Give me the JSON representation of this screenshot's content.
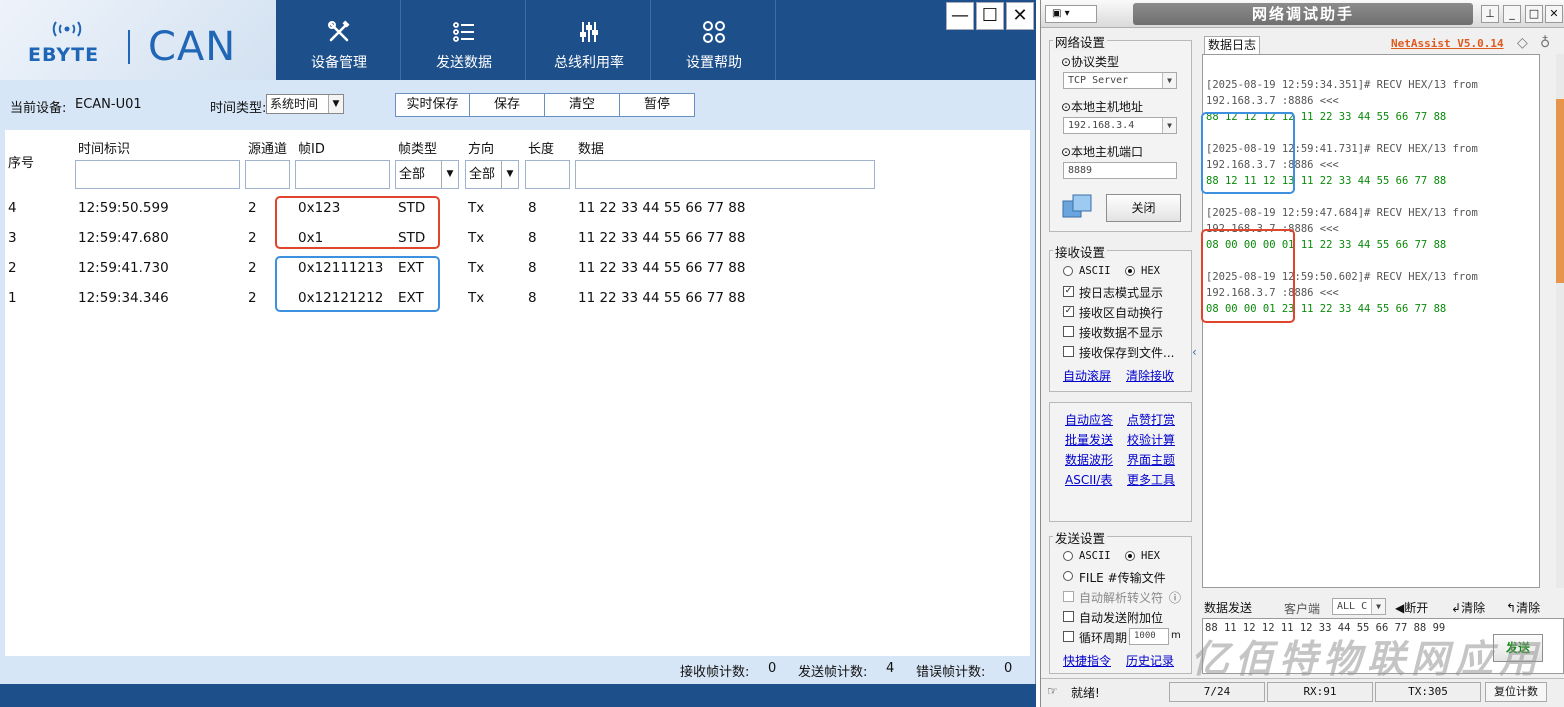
{
  "ecan": {
    "brand_text": "EBYTE",
    "product_text": "CAN",
    "nav": [
      {
        "label": "设备管理",
        "icon": "tools-icon"
      },
      {
        "label": "发送数据",
        "icon": "list-icon"
      },
      {
        "label": "总线利用率",
        "icon": "sliders-icon"
      },
      {
        "label": "设置帮助",
        "icon": "grid-circles-icon"
      }
    ],
    "window_buttons": [
      "—",
      "☐",
      "✕"
    ],
    "device_label": "当前设备:",
    "device_value": "ECAN-U01",
    "time_type_label": "时间类型:",
    "time_type_value": "系统时间",
    "actions": [
      "实时保存",
      "保存",
      "清空",
      "暂停"
    ],
    "columns": {
      "index": "序号",
      "timestamp": "时间标识",
      "channel": "源通道",
      "frame_id": "帧ID",
      "frame_type": "帧类型",
      "direction": "方向",
      "length": "长度",
      "data": "数据"
    },
    "filters": {
      "frame_type": "全部",
      "direction": "全部"
    },
    "rows": [
      {
        "index": "4",
        "time": "12:59:50.599",
        "channel": "2",
        "id": "0x123",
        "type": "STD",
        "dir": "Tx",
        "len": "8",
        "data": "11 22 33 44 55 66 77 88"
      },
      {
        "index": "3",
        "time": "12:59:47.680",
        "channel": "2",
        "id": "0x1",
        "type": "STD",
        "dir": "Tx",
        "len": "8",
        "data": "11 22 33 44 55 66 77 88"
      },
      {
        "index": "2",
        "time": "12:59:41.730",
        "channel": "2",
        "id": "0x12111213",
        "type": "EXT",
        "dir": "Tx",
        "len": "8",
        "data": "11 22 33 44 55 66 77 88"
      },
      {
        "index": "1",
        "time": "12:59:34.346",
        "channel": "2",
        "id": "0x12121212",
        "type": "EXT",
        "dir": "Tx",
        "len": "8",
        "data": "11 22 33 44 55 66 77 88"
      }
    ],
    "status": {
      "recv_label": "接收帧计数:",
      "recv_value": "0",
      "send_label": "发送帧计数:",
      "send_value": "4",
      "err_label": "错误帧计数:",
      "err_value": "0"
    },
    "highlight_colors": {
      "red": "#e0442a",
      "blue": "#3d8fe0"
    },
    "colors": {
      "nav_bg": "#1d4f8b",
      "body_bg": "#d7e6f7",
      "brand": "#2066b6"
    }
  },
  "net": {
    "title": "网络调试助手",
    "version": "NetAssist V5.0.14",
    "net_settings": {
      "group_title": "网络设置",
      "protocol_label": "⊙协议类型",
      "protocol_value": "TCP Server",
      "host_label": "⊙本地主机地址",
      "host_value": "192.168.3.4",
      "port_label": "⊙本地主机端口",
      "port_value": "8889",
      "close_button": "关闭"
    },
    "recv_settings": {
      "group_title": "接收设置",
      "ascii": "ASCII",
      "hex": "HEX",
      "options": [
        "按日志模式显示",
        "接收区自动换行",
        "接收数据不显示",
        "接收保存到文件..."
      ],
      "options_checked": [
        true,
        true,
        false,
        false
      ],
      "auto_scroll": "自动滚屏",
      "clear_recv": "清除接收"
    },
    "tools": [
      "自动应答",
      "点赞打赏",
      "批量发送",
      "校验计算",
      "数据波形",
      "界面主题",
      "ASCII/表",
      "更多工具"
    ],
    "send_settings": {
      "group_title": "发送设置",
      "ascii": "ASCII",
      "hex": "HEX",
      "file": "FILE #传输文件",
      "escape": "自动解析转义符",
      "append": "自动发送附加位",
      "cycle": "循环周期",
      "cycle_value": "1000",
      "cycle_unit": "m",
      "shortcut": "快捷指令",
      "history": "历史记录"
    },
    "log_tab": "数据日志",
    "log": [
      {
        "header": "[2025-08-19 12:59:34.351]# RECV HEX/13 from",
        "source": "192.168.3.7 :8886 <<<",
        "data": "88 12 12 12 12 11 22 33 44 55 66 77 88"
      },
      {
        "header": "[2025-08-19 12:59:41.731]# RECV HEX/13 from",
        "source": "192.168.3.7 :8886 <<<",
        "data": "88 12 11 12 13 11 22 33 44 55 66 77 88"
      },
      {
        "header": "[2025-08-19 12:59:47.684]# RECV HEX/13 from",
        "source": "192.168.3.7 :8886 <<<",
        "data": "08 00 00 00 01 11 22 33 44 55 66 77 88"
      },
      {
        "header": "[2025-08-19 12:59:50.602]# RECV HEX/13 from",
        "source": "192.168.3.7 :8886 <<<",
        "data": "08 00 00 01 23 11 22 33 44 55 66 77 88"
      }
    ],
    "send_bar": {
      "tab": "数据发送",
      "client_label": "客户端",
      "client_value": "ALL C",
      "disconnect": "断开",
      "clear1": "清除",
      "clear2": "清除",
      "send_text": "88 11 12 12 11 12 33 44 55 66 77 88 99",
      "send_button": "发送"
    },
    "statusbar": {
      "ready": "就绪!",
      "count": "7/24",
      "rx": "RX:91",
      "tx": "TX:305",
      "reset": "复位计数"
    },
    "watermark": "亿佰特物联网应用"
  }
}
